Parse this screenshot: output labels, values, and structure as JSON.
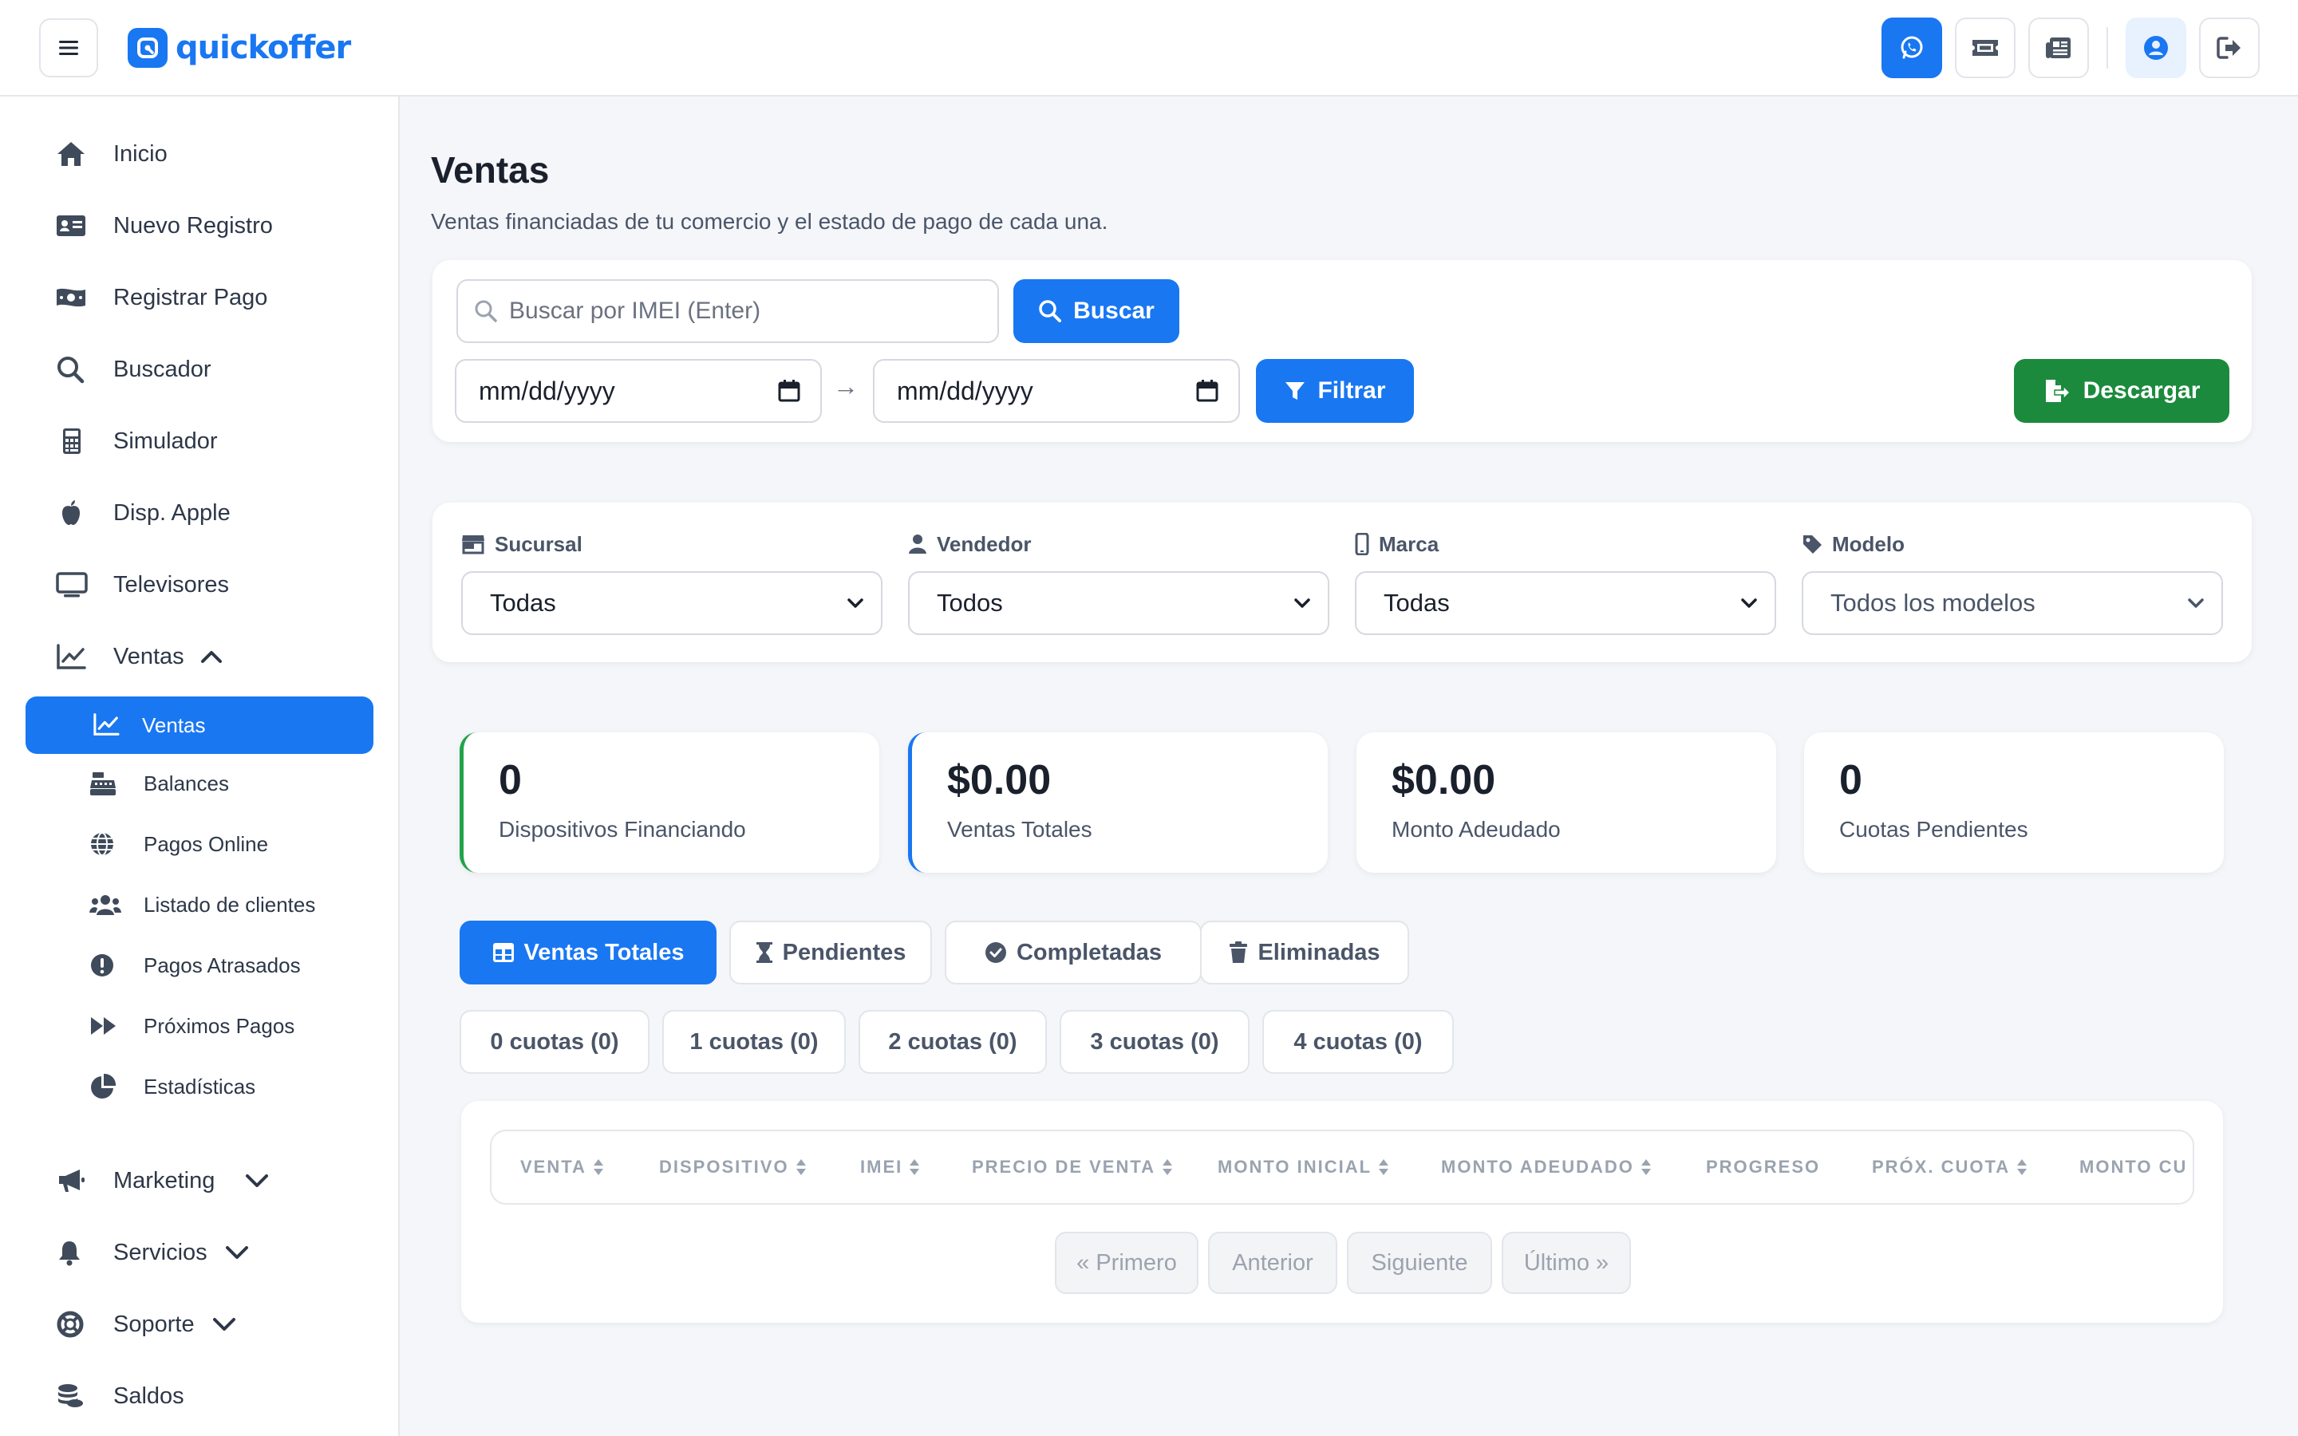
{
  "app": {
    "logo_text": "quickoffer",
    "brand_color": "#1977f2"
  },
  "header": {
    "menu_icon": "hamburger-icon",
    "actions": [
      {
        "name": "whatsapp",
        "icon": "whatsapp-icon"
      },
      {
        "name": "ticket",
        "icon": "ticket-icon"
      },
      {
        "name": "news",
        "icon": "newspaper-icon"
      },
      {
        "name": "profile",
        "icon": "user-circle-icon"
      },
      {
        "name": "logout",
        "icon": "logout-icon"
      }
    ]
  },
  "sidebar": {
    "items": [
      {
        "label": "Inicio",
        "icon": "home-icon"
      },
      {
        "label": "Nuevo Registro",
        "icon": "id-card-icon"
      },
      {
        "label": "Registrar Pago",
        "icon": "money-icon"
      },
      {
        "label": "Buscador",
        "icon": "search-icon"
      },
      {
        "label": "Simulador",
        "icon": "calculator-icon"
      },
      {
        "label": "Disp. Apple",
        "icon": "apple-icon"
      },
      {
        "label": "Televisores",
        "icon": "tv-icon"
      },
      {
        "label": "Ventas",
        "icon": "chart-line-icon",
        "expanded": true
      }
    ],
    "ventas_sub": [
      {
        "label": "Ventas",
        "icon": "chart-line-icon",
        "active": true
      },
      {
        "label": "Balances",
        "icon": "cash-register-icon"
      },
      {
        "label": "Pagos Online",
        "icon": "globe-icon"
      },
      {
        "label": "Listado de clientes",
        "icon": "users-icon"
      },
      {
        "label": "Pagos Atrasados",
        "icon": "exclamation-circle-icon"
      },
      {
        "label": "Próximos Pagos",
        "icon": "forward-icon"
      },
      {
        "label": "Estadísticas",
        "icon": "pie-chart-icon"
      }
    ],
    "bottom_items": [
      {
        "label": "Marketing",
        "icon": "megaphone-icon"
      },
      {
        "label": "Servicios",
        "icon": "bell-icon"
      },
      {
        "label": "Soporte",
        "icon": "lifebuoy-icon"
      },
      {
        "label": "Saldos",
        "icon": "coins-icon"
      }
    ]
  },
  "page": {
    "title": "Ventas",
    "subtitle": "Ventas financiadas de tu comercio y el estado de pago de cada una."
  },
  "search": {
    "placeholder": "Buscar por IMEI (Enter)",
    "value": "",
    "button": "Buscar",
    "date_from": "mm/dd/yyyy",
    "date_to": "mm/dd/yyyy",
    "arrow": "→",
    "filter_button": "Filtrar",
    "download_button": "Descargar"
  },
  "filters": [
    {
      "label": "Sucursal",
      "icon": "store-icon",
      "selected": "Todas"
    },
    {
      "label": "Vendedor",
      "icon": "user-icon",
      "selected": "Todos"
    },
    {
      "label": "Marca",
      "icon": "mobile-icon",
      "selected": "Todas"
    },
    {
      "label": "Modelo",
      "icon": "tag-icon",
      "selected": "Todos los modelos"
    }
  ],
  "stats": [
    {
      "value": "0",
      "label": "Dispositivos Financiando",
      "accent": "#22a34a"
    },
    {
      "value": "$0.00",
      "label": "Ventas Totales",
      "accent": "#1977f2"
    },
    {
      "value": "$0.00",
      "label": "Monto Adeudado"
    },
    {
      "value": "0",
      "label": "Cuotas Pendientes"
    }
  ],
  "tabs": [
    {
      "label": "Ventas Totales",
      "icon": "table-icon",
      "active": true
    },
    {
      "label": "Pendientes",
      "icon": "hourglass-icon"
    },
    {
      "label": "Completadas",
      "icon": "check-circle-icon"
    },
    {
      "label": "Eliminadas",
      "icon": "trash-icon"
    }
  ],
  "cuotas_filters": [
    "0 cuotas (0)",
    "1 cuotas (0)",
    "2 cuotas (0)",
    "3 cuotas (0)",
    "4 cuotas (0)"
  ],
  "table": {
    "columns": [
      {
        "label": "VENTA",
        "sortable": true
      },
      {
        "label": "DISPOSITIVO",
        "sortable": true
      },
      {
        "label": "IMEI",
        "sortable": true
      },
      {
        "label": "PRECIO DE VENTA",
        "sortable": true
      },
      {
        "label": "MONTO INICIAL",
        "sortable": true
      },
      {
        "label": "MONTO ADEUDADO",
        "sortable": true
      },
      {
        "label": "PROGRESO",
        "sortable": false
      },
      {
        "label": "PRÓX. CUOTA",
        "sortable": true
      },
      {
        "label": "MONTO CU",
        "sortable": false
      }
    ],
    "rows": []
  },
  "pagination": {
    "first": "« Primero",
    "prev": "Anterior",
    "next": "Siguiente",
    "last": "Último »"
  }
}
